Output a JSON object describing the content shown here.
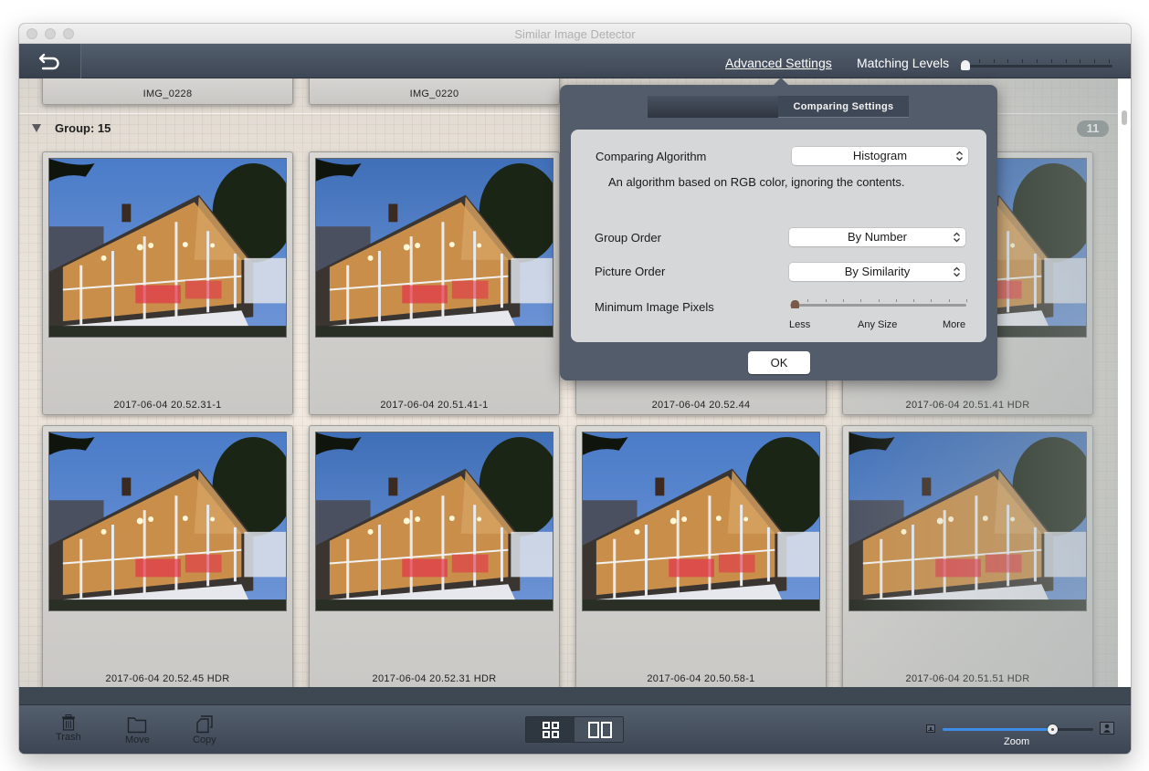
{
  "window": {
    "title": "Similar Image Detector"
  },
  "toolbar": {
    "back_icon": "undo-arrow-icon",
    "advanced_settings_label": "Advanced Settings",
    "matching_levels_label": "Matching Levels",
    "matching_level_value": 0,
    "matching_level_steps": 10
  },
  "previous_group": {
    "cards": [
      {
        "caption": "IMG_0228"
      },
      {
        "caption": "IMG_0220"
      }
    ]
  },
  "group": {
    "label": "Group: 15",
    "count": "11",
    "images": [
      {
        "caption": "2017-06-04 20.52.31-1"
      },
      {
        "caption": "2017-06-04 20.51.41-1"
      },
      {
        "caption": "2017-06-04 20.52.44"
      },
      {
        "caption": "2017-06-04 20.51.41 HDR"
      },
      {
        "caption": "2017-06-04 20.52.45 HDR"
      },
      {
        "caption": "2017-06-04 20.52.31 HDR"
      },
      {
        "caption": "2017-06-04 20.50.58-1"
      },
      {
        "caption": "2017-06-04 20.51.51 HDR"
      }
    ]
  },
  "settings_popover": {
    "tab_label": "Comparing Settings",
    "comparing_algorithm": {
      "label": "Comparing Algorithm",
      "value": "Histogram",
      "description": "An algorithm based on RGB color, ignoring the contents."
    },
    "group_order": {
      "label": "Group Order",
      "value": "By Number"
    },
    "picture_order": {
      "label": "Picture Order",
      "value": "By Similarity"
    },
    "minimum_image_pixels": {
      "label": "Minimum Image Pixels",
      "value": 0,
      "steps": 11,
      "min_label": "Less",
      "mid_label": "Any Size",
      "max_label": "More"
    },
    "ok_label": "OK"
  },
  "bottombar": {
    "trash_label": "Trash",
    "move_label": "Move",
    "copy_label": "Copy",
    "view_mode": "grid",
    "zoom_label": "Zoom",
    "zoom_fraction": 0.73
  },
  "colors": {
    "accent": "#3d8ee8",
    "toolbar": "#4a5463",
    "popover": "#525c6a"
  }
}
